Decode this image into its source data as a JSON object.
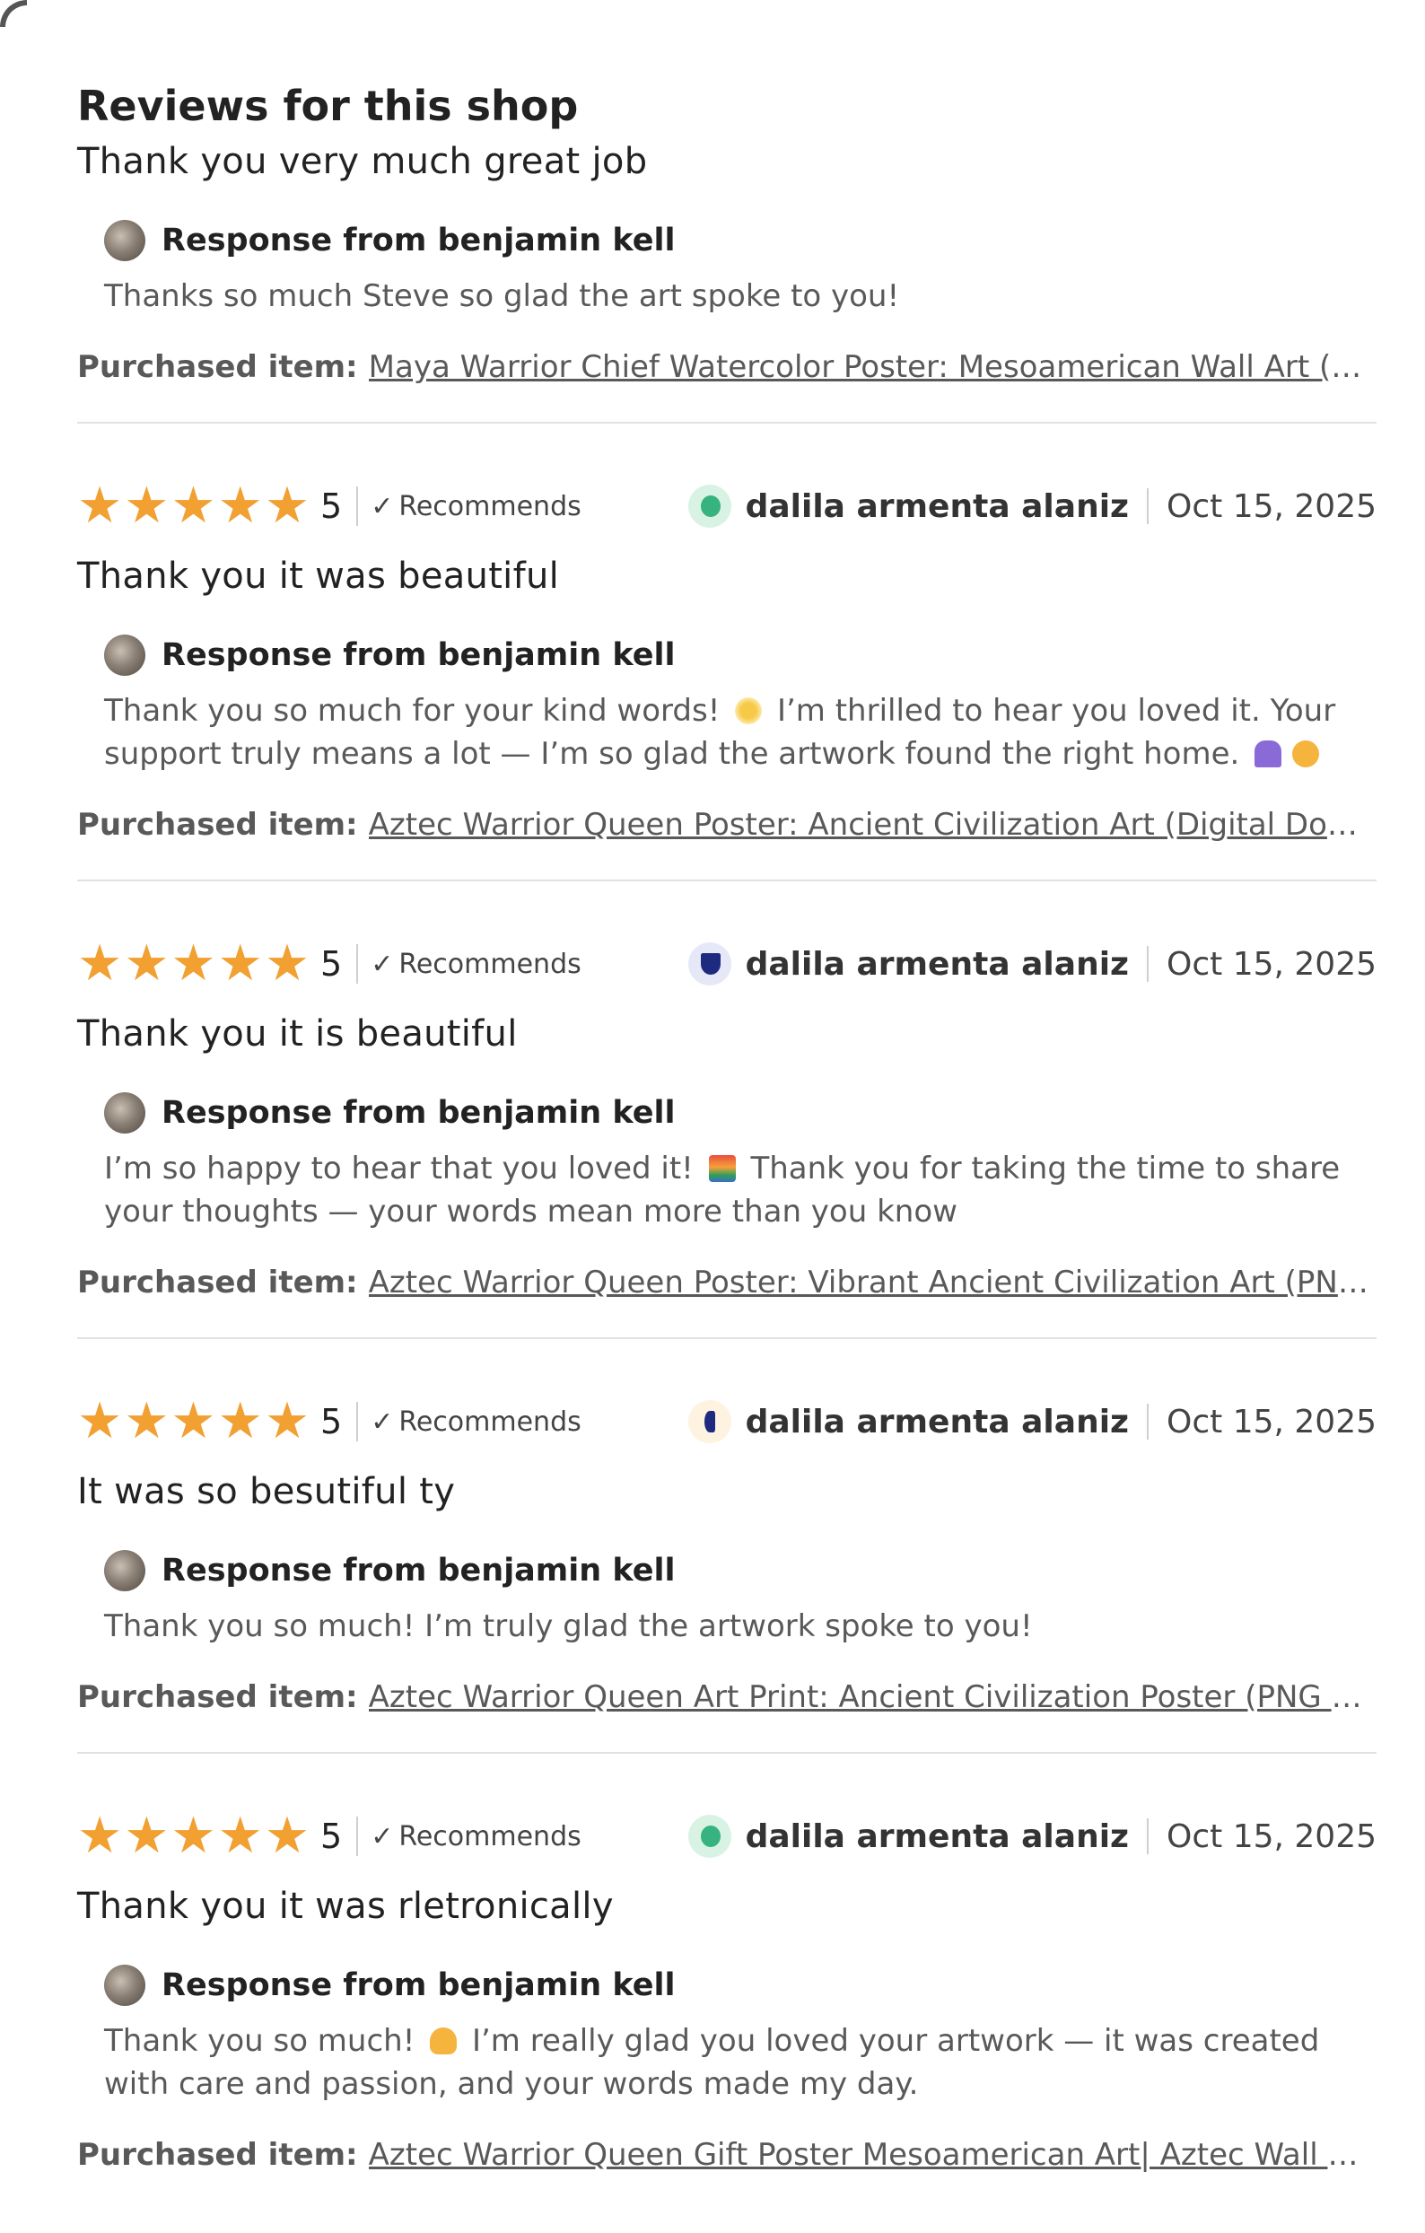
{
  "header": {
    "title": "Reviews for this shop"
  },
  "first_review": {
    "text": "Thank you very much great job",
    "response": {
      "label": "Response from benjamin kell",
      "body": "Thanks so much Steve so glad the art spoke to you!"
    },
    "purchased": {
      "label": "Purchased item:",
      "item": "Maya Warrior Chief Watercolor Poster: Mesoamerican Wall Art (5 PN..."
    }
  },
  "reviews": [
    {
      "rating": "5",
      "recommends": "Recommends",
      "user": "dalila armenta alaniz",
      "date": "Oct 15, 2025",
      "avatar_color": "#d8f3e3",
      "avatar_inner": "#36b37e",
      "text": "Thank you it was beautiful",
      "response": {
        "label": "Response from benjamin kell",
        "body_a": "Thank you so much for your kind words!",
        "emoji_a": "sun-emoji",
        "body_b": "I’m thrilled to hear you loved it. Your support truly means a lot — I’m so glad the artwork found the right home.",
        "emoji_b": "praying-hands-and-heart-emoji"
      },
      "purchased": {
        "label": "Purchased item:",
        "item": "Aztec Warrior Queen Poster: Ancient Civilization Art (Digital Downloa..."
      }
    },
    {
      "rating": "5",
      "recommends": "Recommends",
      "user": "dalila armenta alaniz",
      "date": "Oct 15, 2025",
      "avatar_color": "#e6e8f7",
      "avatar_inner": "#1d2a80",
      "text": "Thank you it is beautiful",
      "response": {
        "label": "Response from benjamin kell",
        "body_a": "I’m so happy to hear that you loved it!",
        "emoji_a": "sunset-emoji",
        "body_b": "Thank you for taking the time to share your thoughts — your words mean more than you know"
      },
      "purchased": {
        "label": "Purchased item:",
        "item": "Aztec Warrior Queen Poster: Vibrant Ancient Civilization Art (PNG Di..."
      }
    },
    {
      "rating": "5",
      "recommends": "Recommends",
      "user": "dalila armenta alaniz",
      "date": "Oct 15, 2025",
      "avatar_color": "#fdf3e0",
      "avatar_inner": "#1d2a80",
      "text": "It was so besutiful ty",
      "response": {
        "label": "Response from benjamin kell",
        "body": "Thank you so much! I’m truly glad the artwork spoke to you!"
      },
      "purchased": {
        "label": "Purchased item:",
        "item": "Aztec Warrior Queen Art Print: Ancient Civilization Poster (PNG Files)"
      }
    },
    {
      "rating": "5",
      "recommends": "Recommends",
      "user": "dalila armenta alaniz",
      "date": "Oct 15, 2025",
      "avatar_color": "#d8f3e3",
      "avatar_inner": "#36b37e",
      "text": "Thank you it was rletronically",
      "response": {
        "label": "Response from benjamin kell",
        "body_a": "Thank you so much!",
        "emoji_a": "hands-emoji",
        "body_b": "I’m really glad you loved your artwork — it was created with care and passion, and your words made my day."
      },
      "purchased": {
        "label": "Purchased item:",
        "item": "Aztec Warrior Queen Gift Poster Mesoamerican Art| Aztec Wall Deco..."
      }
    }
  ],
  "colors": {
    "star": "#f1a031",
    "divider": "#e1e1e1",
    "text_primary": "#222222",
    "text_secondary": "#595959"
  },
  "icons": {
    "star": "star-icon",
    "check": "check-icon"
  }
}
